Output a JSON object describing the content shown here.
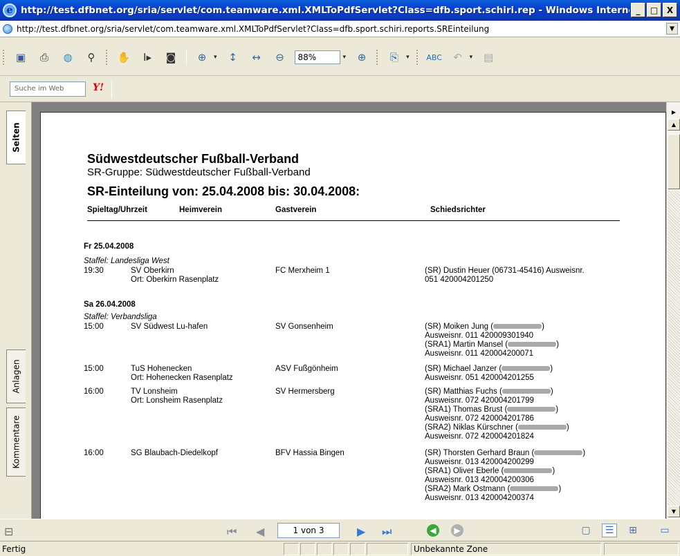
{
  "window": {
    "title": "http://test.dfbnet.org/sria/servlet/com.teamware.xml.XMLToPdfServlet?Class=dfb.sport.schiri.rep - Windows Interne...",
    "btn_min": "_",
    "btn_max": "□",
    "btn_close": "X"
  },
  "address": {
    "url": "http://test.dfbnet.org/sria/servlet/com.teamware.xml.XMLToPdfServlet?Class=dfb.sport.schiri.reports.SREinteilung"
  },
  "toolbar": {
    "zoom": "88%"
  },
  "search": {
    "placeholder": "Suche im Web",
    "yahoo_label": "Y!"
  },
  "leftnav": {
    "tab_pages": "Seiten",
    "tab_attachments": "Anlagen",
    "tab_comments": "Kommentare"
  },
  "doc": {
    "org": "Südwestdeutscher Fußball-Verband",
    "group": "SR-Gruppe: Südwestdeutscher Fußball-Verband",
    "heading": "SR-Einteilung von: 25.04.2008 bis: 30.04.2008:",
    "col_time": "Spieltag/Uhrzeit",
    "col_home": "Heimverein",
    "col_guest": "Gastverein",
    "col_ref": "Schiedsrichter",
    "day1": "Fr 25.04.2008",
    "staffel1": "Staffel: Landesliga West",
    "m1_time": "19:30",
    "m1_home": "SV Oberkirn",
    "m1_venue": "Ort: Oberkirn Rasenplatz",
    "m1_guest": "FC Merxheim 1",
    "m1_ref1": "(SR) Dustin Heuer (06731-45416) Ausweisnr.",
    "m1_ref2": "051 420004201250",
    "day2": "Sa 26.04.2008",
    "staffel2": "Staffel: Verbandsliga",
    "m2_time": "15:00",
    "m2_home": "SV Südwest Lu-hafen",
    "m2_guest": "SV Gonsenheim",
    "m2_ref1": "(SR) Moiken Jung (",
    "m2_ref2": "Ausweisnr. 011 420009301940",
    "m2_ref3": "(SRA1) Martin Mansel (",
    "m2_ref4": "Ausweisnr. 011 420004200071",
    "m3_time": "15:00",
    "m3_home": "TuS Hohenecken",
    "m3_venue": "Ort: Hohenecken Rasenplatz",
    "m3_guest": "ASV Fußgönheim",
    "m3_ref1": "(SR) Michael Janzer (",
    "m3_ref2": "Ausweisnr. 051 420004201255",
    "m4_time": "16:00",
    "m4_home": "TV Lonsheim",
    "m4_venue": "Ort: Lonsheim Rasenplatz",
    "m4_guest": "SV Hermersberg",
    "m4_ref1": "(SR) Matthias Fuchs (",
    "m4_ref2": "Ausweisnr. 072 420004201799",
    "m4_ref3": "(SRA1) Thomas Brust (",
    "m4_ref4": "Ausweisnr. 072 420004201786",
    "m4_ref5": "(SRA2) Niklas Kürschner (",
    "m4_ref6": "Ausweisnr. 072 420004201824",
    "m5_time": "16:00",
    "m5_home": "SG Blaubach-Diedelkopf",
    "m5_guest": "BFV Hassia Bingen",
    "m5_ref1": "(SR) Thorsten Gerhard Braun (",
    "m5_ref2": "Ausweisnr. 013 420004200299",
    "m5_ref3": "(SRA1) Oliver Eberle (",
    "m5_ref4": "Ausweisnr. 013 420004200306",
    "m5_ref5": "(SRA2) Mark Ostmann (",
    "m5_ref6": "Ausweisnr. 013 420004200374",
    "close_paren": ")"
  },
  "nav": {
    "page_indicator": "1 von 3"
  },
  "status": {
    "text": "Fertig",
    "zone": "Unbekannte Zone"
  }
}
